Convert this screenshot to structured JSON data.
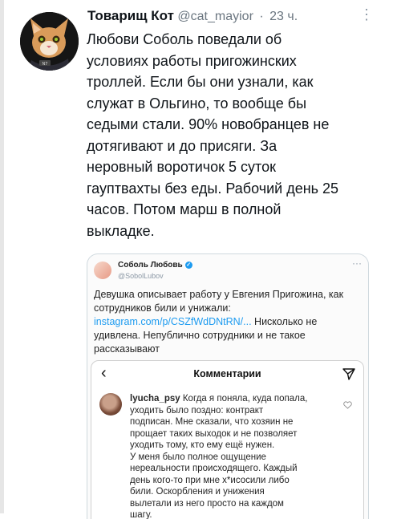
{
  "tweet": {
    "author_name": "Товарищ Кот",
    "author_handle": "@cat_mayior",
    "separator": "·",
    "time": "23 ч.",
    "more_label": "⋮",
    "text": "Любови Соболь поведали об\nусловиях работы пригожинских\nтроллей. Если бы они узнали, как\nслужат в Ольгино, то вообще бы\nседыми стали. 90% новобранцев не\nдотягивают и до присяги. За\nнеровный воротичок 5 суток\nгауптвахты без еды. Рабочий день 25\nчасов. Потом марш в полной\nвыкладке."
  },
  "quoted": {
    "author_name": "Соболь Любовь",
    "author_handle": "@SobolLubov",
    "verified_mark": "✓",
    "more_label": "···",
    "text_before_link": "Девушка описывает работу у Евгения Пригожина, как сотрудников били и унижали: ",
    "link": "instagram.com/p/CSZfWdDNtRN/...",
    "text_after_link": " Нисколько не удивлена. Непублично сотрудники и не такое рассказывают"
  },
  "comments_panel": {
    "back_label": "‹",
    "title": "Комментарии",
    "comment": {
      "username": "lyucha_psy",
      "text": " Когда я поняла, куда попала,\nуходить было поздно: контракт\nподписан. Мне сказали, что хозяин не\nпрощает таких выходок и не позволяет\nуходить тому, кто ему ещё нужен.\nУ меня было полное ощущение\nнереальности происходящего. Каждый\nдень кого-то при мне х*исосили либо\nбили. Оскорбления и унижения\nвылетали из него просто на каждом\nшагу."
    }
  },
  "colors": {
    "link": "#1d9bf0",
    "verified": "#1d9bf0",
    "secondary_text": "#6b7680"
  }
}
